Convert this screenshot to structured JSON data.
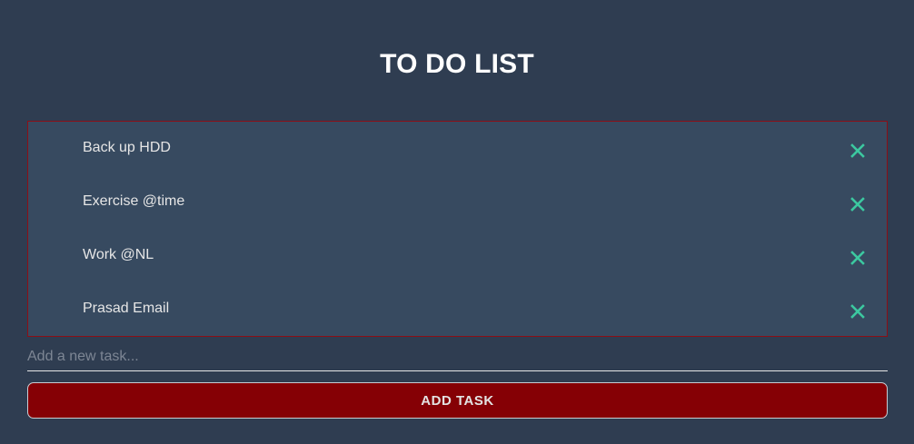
{
  "header": {
    "title": "TO DO LIST"
  },
  "tasks": [
    {
      "label": "Back up HDD"
    },
    {
      "label": "Exercise @time"
    },
    {
      "label": "Work @NL"
    },
    {
      "label": "Prasad Email"
    }
  ],
  "delete_icon": "close-icon",
  "input": {
    "value": "",
    "placeholder": "Add a new task..."
  },
  "add_button": {
    "label": "ADD TASK"
  },
  "colors": {
    "background": "#2f3d51",
    "list_background": "#374a60",
    "list_border": "#8b0f17",
    "accent_delete": "#3cc8a0",
    "button_background": "#850005",
    "text": "#e6e6e6"
  }
}
